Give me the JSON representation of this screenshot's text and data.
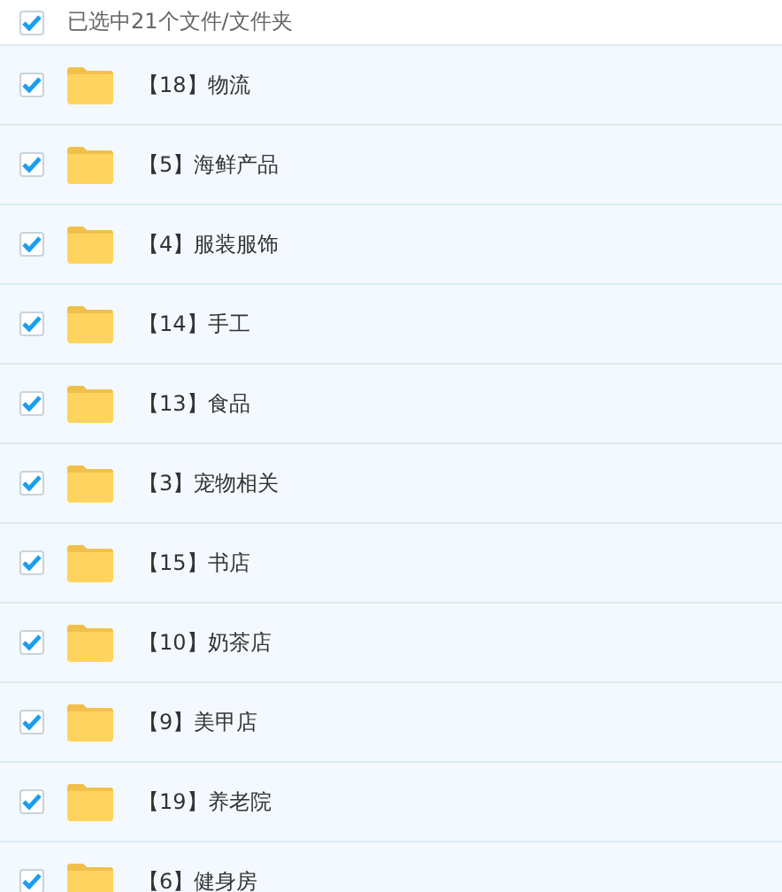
{
  "header": {
    "checked": true,
    "label": "已选中21个文件/文件夹"
  },
  "items": [
    {
      "name": "【18】物流",
      "checked": true
    },
    {
      "name": "【5】海鲜产品",
      "checked": true
    },
    {
      "name": "【4】服装服饰",
      "checked": true
    },
    {
      "name": "【14】手工",
      "checked": true
    },
    {
      "name": "【13】食品",
      "checked": true
    },
    {
      "name": "【3】宠物相关",
      "checked": true
    },
    {
      "name": "【15】书店",
      "checked": true
    },
    {
      "name": "【10】奶茶店",
      "checked": true
    },
    {
      "name": "【9】美甲店",
      "checked": true
    },
    {
      "name": "【19】养老院",
      "checked": true
    },
    {
      "name": "【6】健身房",
      "checked": true
    }
  ]
}
